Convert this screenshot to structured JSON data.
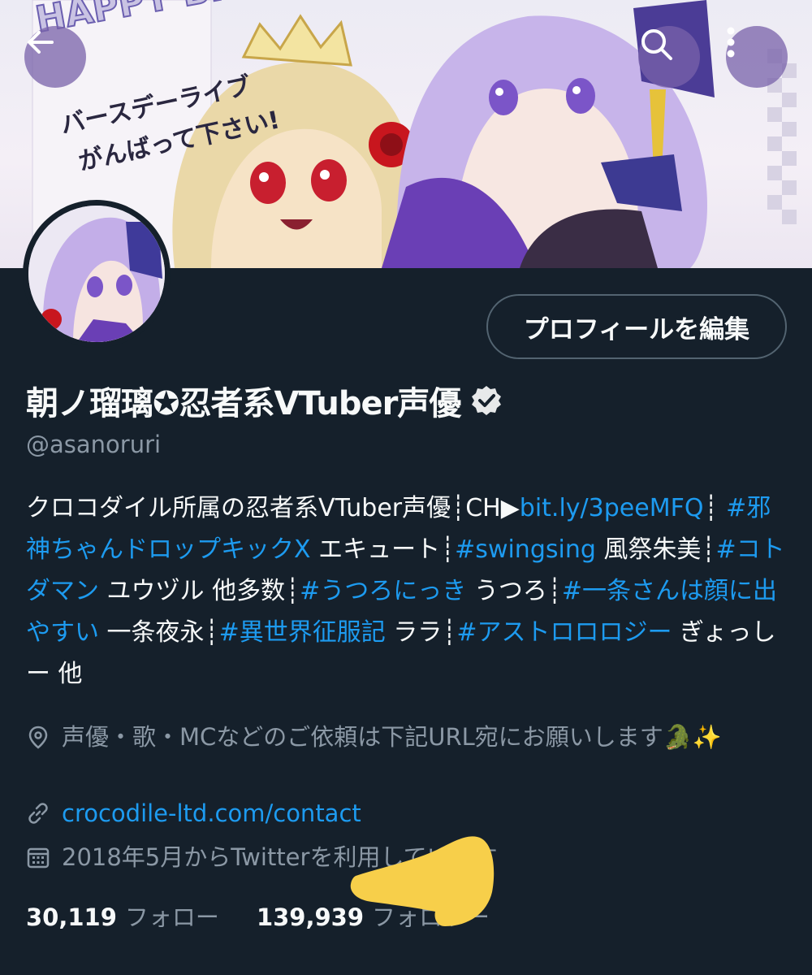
{
  "banner": {
    "headline_text": "HAPPY BIRTHDAY",
    "message_line1": "バースデーライブ",
    "message_line2": "がんばって下さい!",
    "icons": {
      "back": "arrow-left-icon",
      "search": "search-icon",
      "more": "more-vertical-icon"
    }
  },
  "profile": {
    "edit_button_label": "プロフィールを編集",
    "display_name": "朝ノ瑠璃✪忍者系VTuber声優",
    "verified_icon": "verified-badge-icon",
    "handle": "@asanoruri"
  },
  "bio": {
    "segments": [
      {
        "text": "クロコダイル所属の忍者系VTuber声優┊CH▶",
        "link": false
      },
      {
        "text": "bit.ly/3peeMFQ",
        "link": true
      },
      {
        "text": "┊ ",
        "link": false
      },
      {
        "text": "#邪神ちゃんドロップキックX",
        "link": true
      },
      {
        "text": " エキュート┊",
        "link": false
      },
      {
        "text": "#swingsing",
        "link": true
      },
      {
        "text": " 風祭朱美┊",
        "link": false
      },
      {
        "text": "#コトダマン",
        "link": true
      },
      {
        "text": " ユウヅル 他多数┊",
        "link": false
      },
      {
        "text": "#うつろにっき",
        "link": true
      },
      {
        "text": " うつろ┊",
        "link": false
      },
      {
        "text": "#一条さんは顔に出やすい",
        "link": true
      },
      {
        "text": " 一条夜永┊",
        "link": false
      },
      {
        "text": "#異世界征服記",
        "link": true
      },
      {
        "text": " ララ┊",
        "link": false
      },
      {
        "text": "#アストロロロジー",
        "link": true
      },
      {
        "text": " ぎょっしー 他",
        "link": false
      }
    ]
  },
  "meta": {
    "location": "声優・歌・MCなどのご依頼は下記URL宛にお願いします🐊✨",
    "location_icon": "location-pin-icon",
    "website": "crocodile-ltd.com/contact",
    "website_icon": "link-icon",
    "joined": "2018年5月からTwitterを利用しています",
    "joined_icon": "calendar-icon"
  },
  "stats": {
    "following_count": "30,119",
    "following_label": "フォロー",
    "followers_count": "139,939",
    "followers_label": "フォロワー"
  },
  "colors": {
    "background": "#15202b",
    "link": "#1d9bf0",
    "secondary_text": "#8b98a5",
    "primary_text": "#f7f9f9",
    "overlay_finger": "#f7cf4a"
  }
}
